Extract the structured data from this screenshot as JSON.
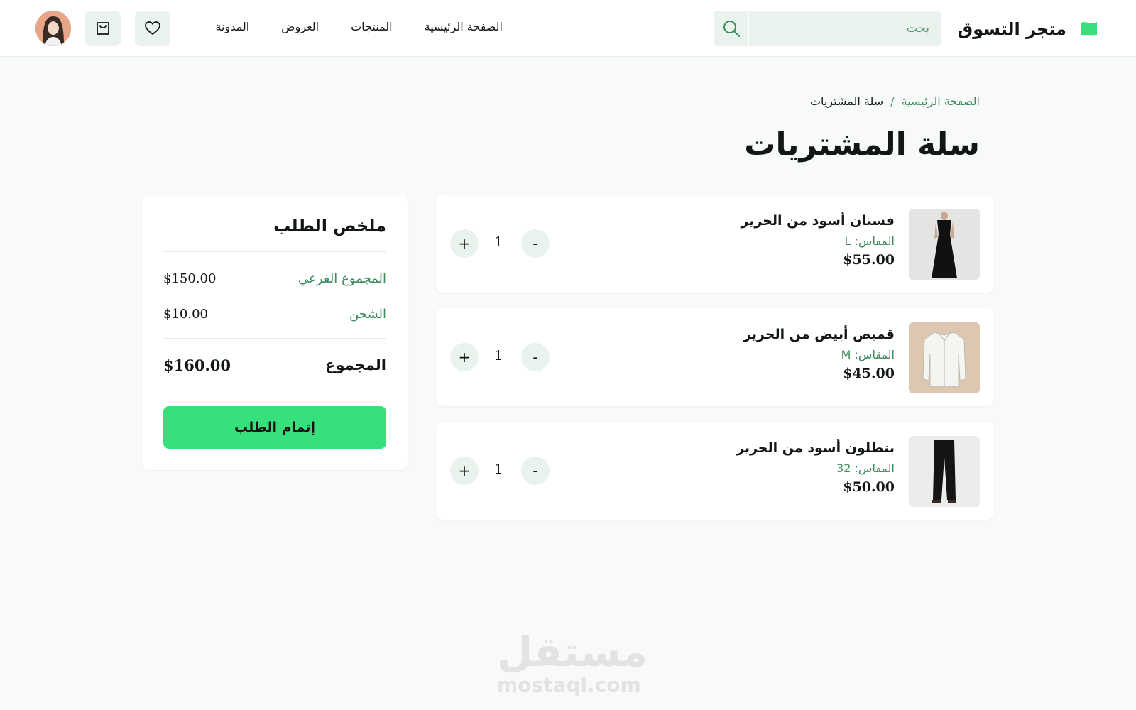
{
  "header": {
    "brand_name": "متجر التسوق",
    "search": {
      "placeholder": "بحث",
      "value": ""
    },
    "nav": [
      {
        "label": "الصفحة الرئيسية"
      },
      {
        "label": "المنتجات"
      },
      {
        "label": "العروض"
      },
      {
        "label": "المدونة"
      }
    ],
    "icons": {
      "search": "search-icon",
      "wishlist": "heart-icon",
      "cart": "shopping-bag-icon",
      "avatar": "user-avatar"
    }
  },
  "breadcrumb": {
    "home": "الصفحة الرئيسية",
    "separator": "/",
    "current": "سلة المشتريات"
  },
  "page_title": "سلة المشتريات",
  "cart": {
    "items": [
      {
        "name": "فستان أسود من الحرير",
        "size": "المقاس: L",
        "price": "$55.00",
        "quantity": "1"
      },
      {
        "name": "قميص أبيض من الحرير",
        "size": "المقاس: M",
        "price": "$45.00",
        "quantity": "1"
      },
      {
        "name": "بنطلون أسود من الحرير",
        "size": "المقاس: 32",
        "price": "$50.00",
        "quantity": "1"
      }
    ],
    "decrement_label": "-",
    "increment_label": "+"
  },
  "summary": {
    "title": "ملخص الطلب",
    "subtotal_label": "المجموع الفرعي",
    "subtotal_value": "$150.00",
    "shipping_label": "الشحن",
    "shipping_value": "$10.00",
    "total_label": "المجموع",
    "total_value": "$160.00",
    "checkout_label": "إتمام الطلب"
  },
  "watermark": {
    "arabic": "مستقل",
    "latin": "mostaql.com"
  },
  "colors": {
    "accent": "#38e07b",
    "accent_text": "#3d8a5c",
    "soft_bg": "#e9f2ec",
    "page_bg": "#f8faf9",
    "text": "#121714"
  }
}
